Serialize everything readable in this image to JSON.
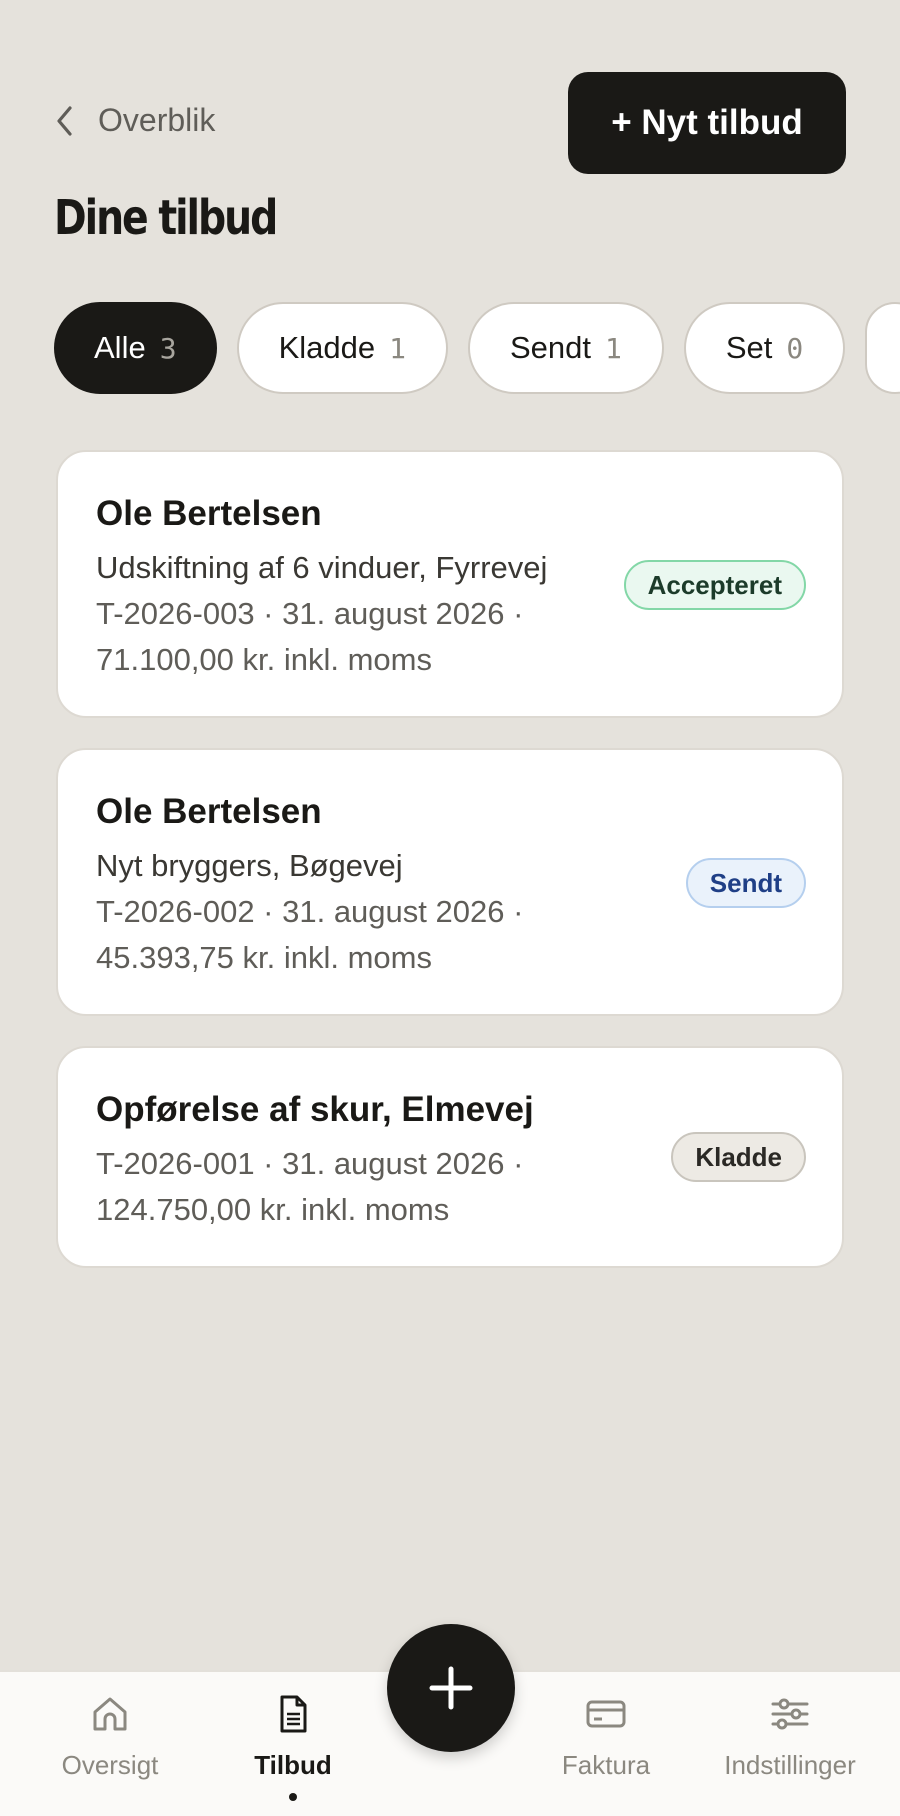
{
  "header": {
    "back_label": "Overblik",
    "new_button_label": "+ Nyt tilbud",
    "title": "Dine tilbud"
  },
  "filters": [
    {
      "label": "Alle",
      "count": "3",
      "active": true
    },
    {
      "label": "Kladde",
      "count": "1"
    },
    {
      "label": "Sendt",
      "count": "1"
    },
    {
      "label": "Set",
      "count": "0"
    }
  ],
  "offers": [
    {
      "customer": "Ole Bertelsen",
      "description": "Udskiftning af 6 vinduer, Fyrrevej",
      "meta": "T-2026-003 · 31. august 2026 ·",
      "amount": "71.100,00 kr. inkl. moms",
      "status": "Accepteret"
    },
    {
      "customer": "Ole Bertelsen",
      "description": "Nyt bryggers, Bøgevej",
      "meta": "T-2026-002 · 31. august 2026 ·",
      "amount": "45.393,75 kr. inkl. moms",
      "status": "Sendt"
    },
    {
      "customer": "Opførelse af skur, Elmevej",
      "meta": "T-2026-001 · 31. august 2026 ·",
      "amount": "124.750,00 kr. inkl. moms",
      "status": "Kladde"
    }
  ],
  "nav": {
    "overview": "Oversigt",
    "offers": "Tilbud",
    "invoices": "Faktura",
    "settings": "Indstillinger"
  },
  "icons": {
    "back": "chevron-left-icon",
    "fab": "plus-icon",
    "overview": "home-icon",
    "offers": "document-icon",
    "invoices": "credit-card-icon",
    "settings": "sliders-icon"
  },
  "colors": {
    "background": "#e5e2dc",
    "primary": "#1a1916",
    "accepted": "#83d7a7",
    "sent": "#1f3f86"
  }
}
